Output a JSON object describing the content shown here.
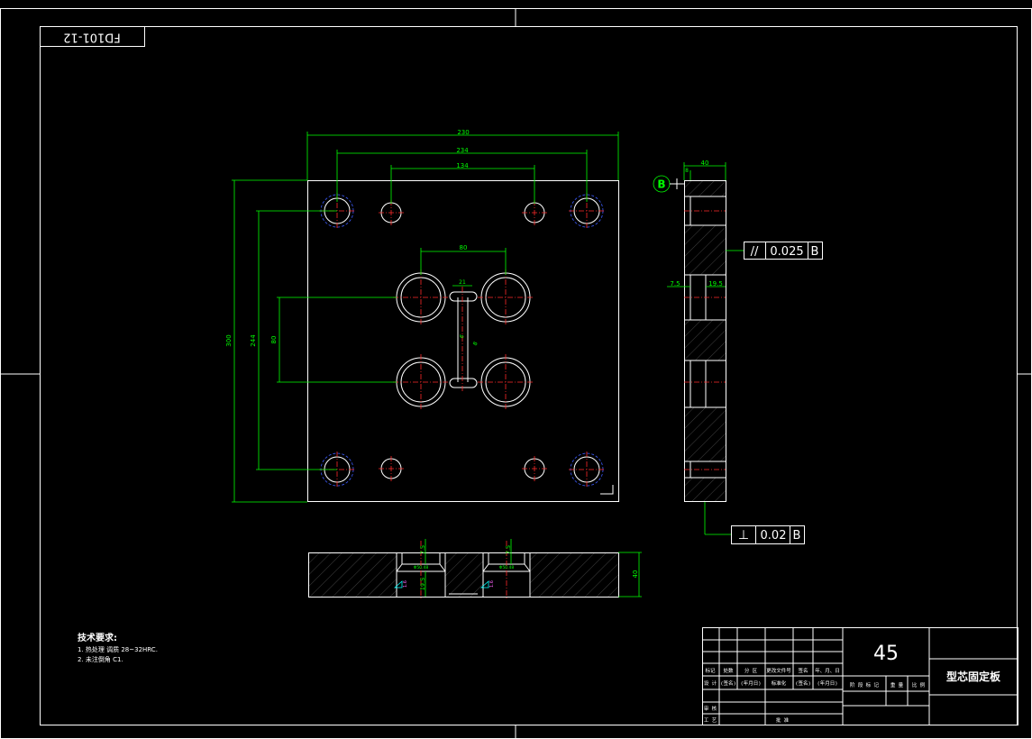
{
  "drawing": {
    "number_mirrored": "FD101-12",
    "plate_dims": {
      "overall_width": "230",
      "bolt_spacing": "234",
      "pin_spacing": "134",
      "cavity_spacing_x": "80",
      "gate_width": "21",
      "overall_height": "300",
      "bolt_spacing_v": "244",
      "cavity_spacing_y": "80",
      "runner_1": "6",
      "runner_2": "8"
    },
    "side_view": {
      "thickness": "40",
      "top_dim": "8",
      "counterbore_depth": "7.5",
      "counterbore_dia": "19.5"
    },
    "section_view": {
      "depth_a": "7.5",
      "depth_b": "7.5",
      "bore_a": "19.5",
      "thickness": "40",
      "roughness_a": "1.6",
      "roughness_b": "1.6",
      "label_a": "Φ50.48",
      "label_b": "Φ50.48"
    },
    "datum": {
      "label": "B"
    },
    "tolerance_parallel": {
      "symbol": "//",
      "value": "0.025",
      "datum": "B"
    },
    "tolerance_perpendicular": {
      "symbol": "⊥",
      "value": "0.02",
      "datum": "B"
    },
    "notes": {
      "title": "技术要求:",
      "line1": "1. 热处理 调质 28~32HRC.",
      "line2": "2. 未注倒角 C1."
    },
    "title_block": {
      "material": "45",
      "part_name": "型芯固定板",
      "header_cells": [
        "标记",
        "处数",
        "分 区",
        "更改文件号",
        "签名",
        "年、月、日"
      ],
      "design_row": [
        "设 计",
        "(签名)",
        "(年月日)",
        "标准化",
        "(签名)",
        "(年月日)"
      ],
      "audit_label": "审 核",
      "process_label": "工 艺",
      "approve_label": "批 准",
      "stage_cells": [
        "阶 段 标 记",
        "重 量",
        "比 例"
      ]
    }
  }
}
